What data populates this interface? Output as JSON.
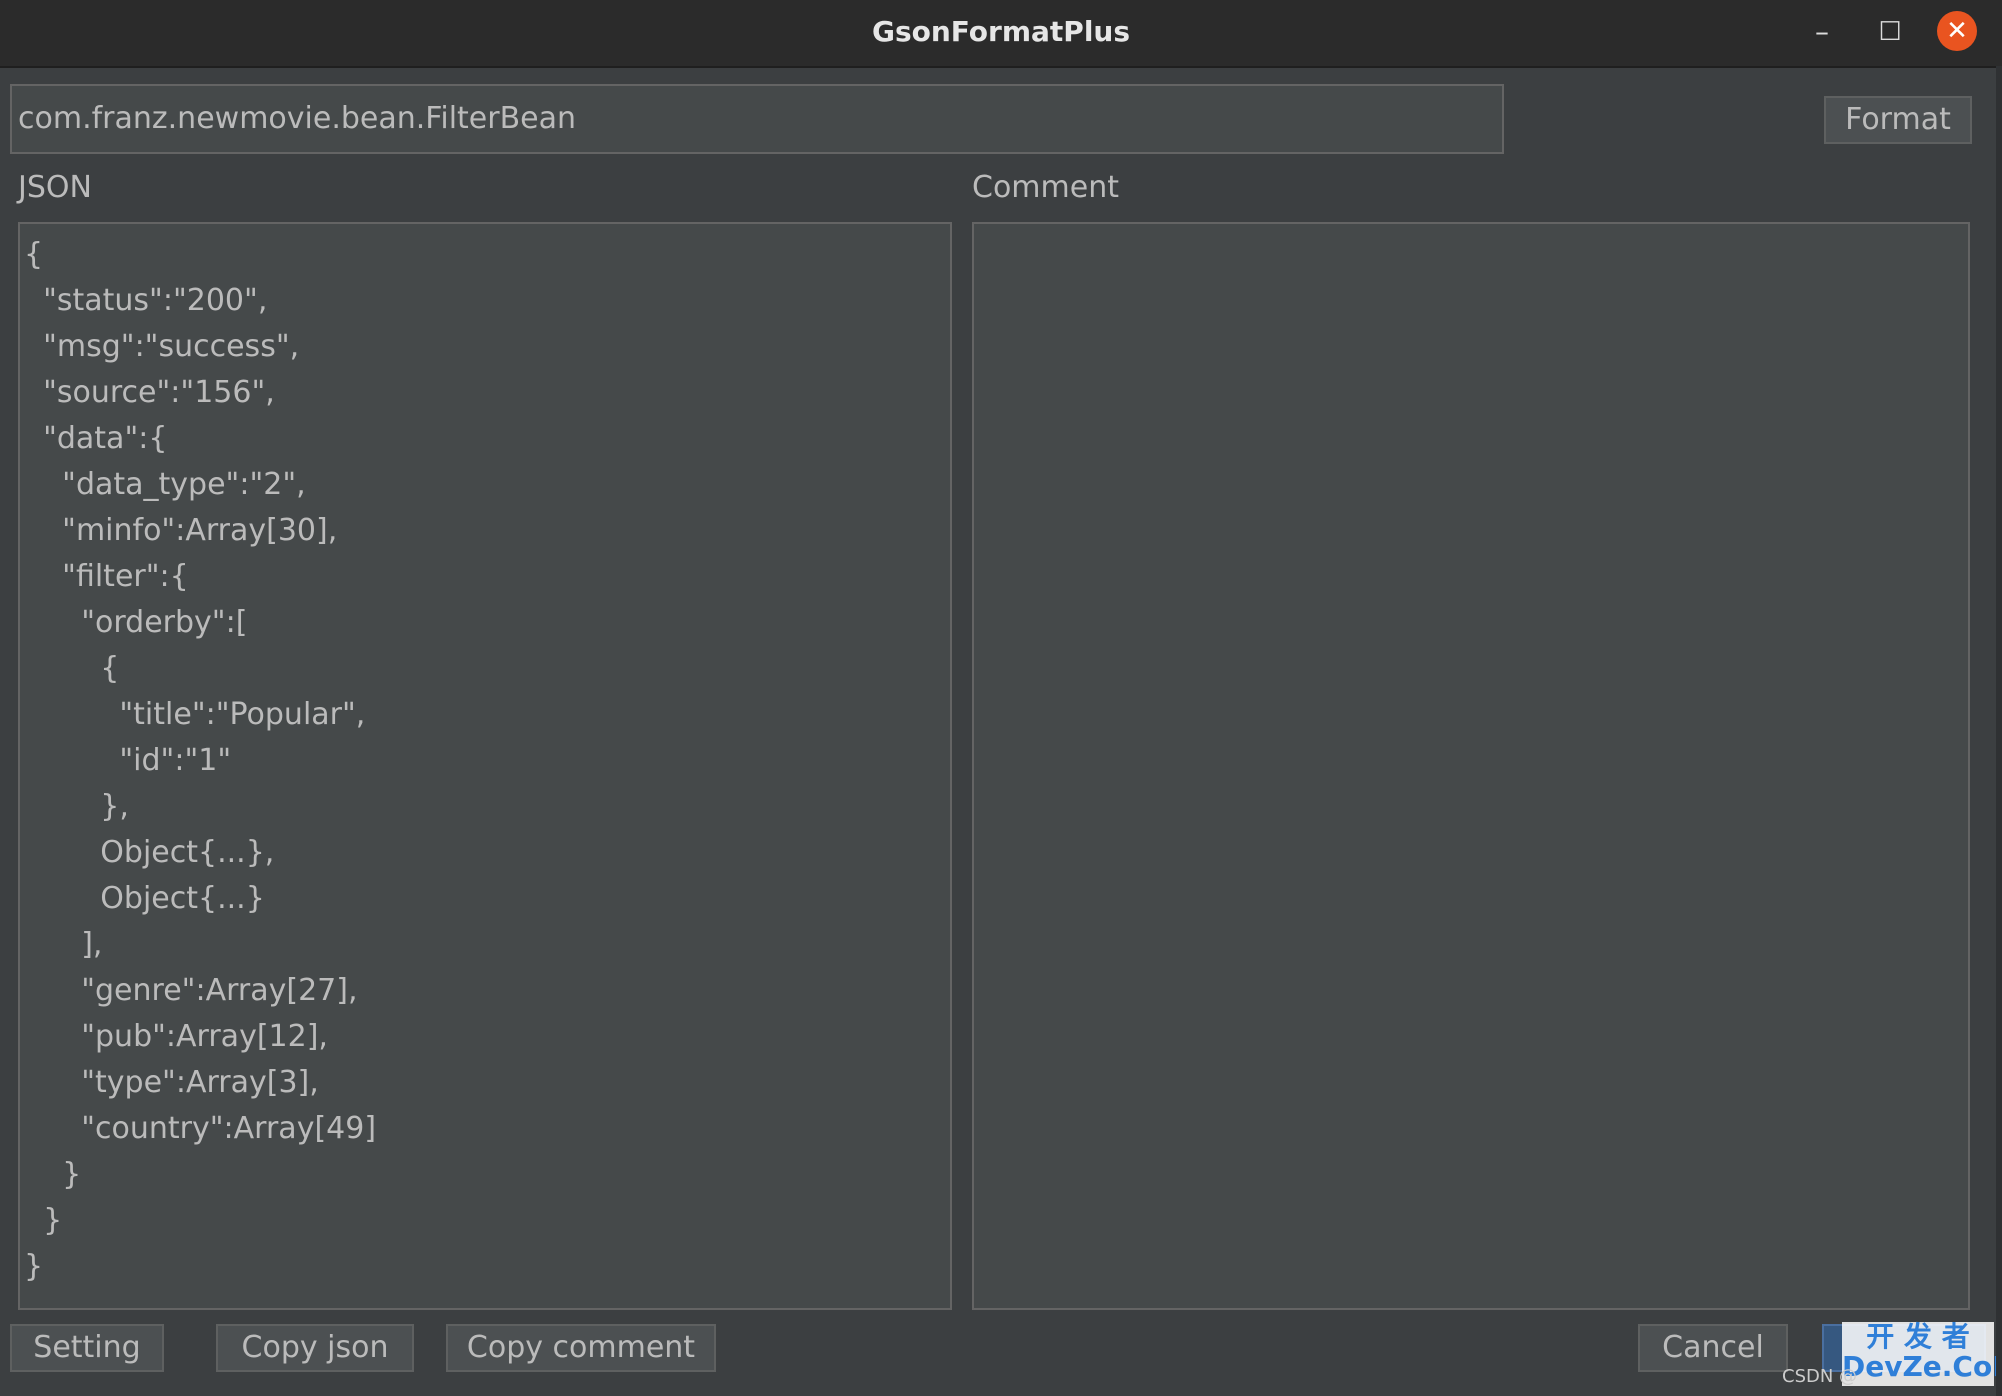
{
  "window": {
    "title": "GsonFormatPlus",
    "minimize": "–",
    "maximize": "☐",
    "close": "✕"
  },
  "class_input": {
    "value": "com.franz.newmovie.bean.FilterBean"
  },
  "toolbar": {
    "format_label": "Format"
  },
  "json_panel": {
    "label": "JSON",
    "lines": [
      "{",
      "  \"status\":\"200\",",
      "  \"msg\":\"success\",",
      "  \"source\":\"156\",",
      "  \"data\":{",
      "    \"data_type\":\"2\",",
      "    \"minfo\":Array[30],",
      "    \"filter\":{",
      "      \"orderby\":[",
      "        {",
      "          \"title\":\"Popular\",",
      "          \"id\":\"1\"",
      "        },",
      "        Object{...},",
      "        Object{...}",
      "      ],",
      "      \"genre\":Array[27],",
      "      \"pub\":Array[12],",
      "      \"type\":Array[3],",
      "      \"country\":Array[49]",
      "    }",
      "  }",
      "}"
    ]
  },
  "comment_panel": {
    "label": "Comment",
    "value": ""
  },
  "buttons": {
    "setting": "Setting",
    "copy_json": "Copy  json",
    "copy_comment": "Copy comment",
    "cancel": "Cancel",
    "ok": ""
  },
  "watermark": {
    "line1": "开 发 者",
    "line2": "DevZe.CoM",
    "csdn": "CSDN @"
  },
  "colors": {
    "background": "#3c3f41",
    "field": "#45494a",
    "text": "#bbbbbb",
    "close": "#e95420"
  }
}
